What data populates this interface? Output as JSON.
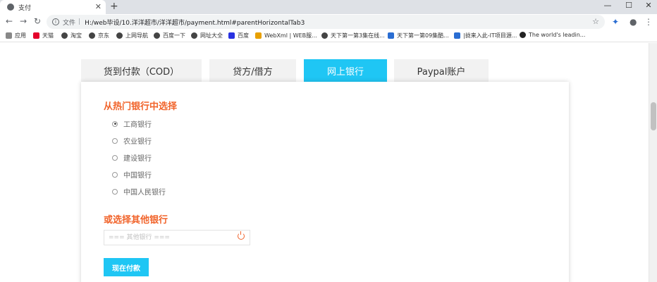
{
  "browser": {
    "tab_title": "支付",
    "url_prefix": "文件",
    "url_separator": "|",
    "url": "H:/web毕设/10.洋洋超市/洋洋超市/payment.html#parentHorizontalTab3",
    "bookmarks": [
      {
        "label": "应用",
        "icon_color": "#888888"
      },
      {
        "label": "天猫",
        "icon_color": "#e4002b"
      },
      {
        "label": "淘宝",
        "icon_color": "#444444"
      },
      {
        "label": "京东",
        "icon_color": "#444444"
      },
      {
        "label": "上网导航",
        "icon_color": "#444444"
      },
      {
        "label": "百度一下",
        "icon_color": "#444444"
      },
      {
        "label": "网址大全",
        "icon_color": "#444444"
      },
      {
        "label": "百度",
        "icon_color": "#2932e1"
      },
      {
        "label": "WebXml | WEB服...",
        "icon_color": "#e8a000"
      },
      {
        "label": "天下第一第3集在线...",
        "icon_color": "#444444"
      },
      {
        "label": "天下第一第09集酷...",
        "icon_color": "#2a6dd2"
      },
      {
        "label": "|拢来入此-IT项目源...",
        "icon_color": "#2a6dd2"
      },
      {
        "label": "The world's leadin...",
        "icon_color": "#222222"
      }
    ]
  },
  "payment_tabs": [
    {
      "label": "货到付款（COD）",
      "active": false
    },
    {
      "label": "贷方/借方",
      "active": false
    },
    {
      "label": "网上银行",
      "active": true
    },
    {
      "label": "Paypal账户",
      "active": false
    }
  ],
  "bank_section": {
    "title": "从热门银行中选择",
    "banks": [
      {
        "label": "工商银行",
        "checked": true
      },
      {
        "label": "农业银行",
        "checked": false
      },
      {
        "label": "建设银行",
        "checked": false
      },
      {
        "label": "中国银行",
        "checked": false
      },
      {
        "label": "中国人民银行",
        "checked": false
      }
    ]
  },
  "other_section": {
    "title": "或选择其他银行",
    "placeholder": "=== 其他银行 ==="
  },
  "pay_button": "现在付款",
  "colors": {
    "accent": "#1fc6f4",
    "title": "#f1632a"
  }
}
